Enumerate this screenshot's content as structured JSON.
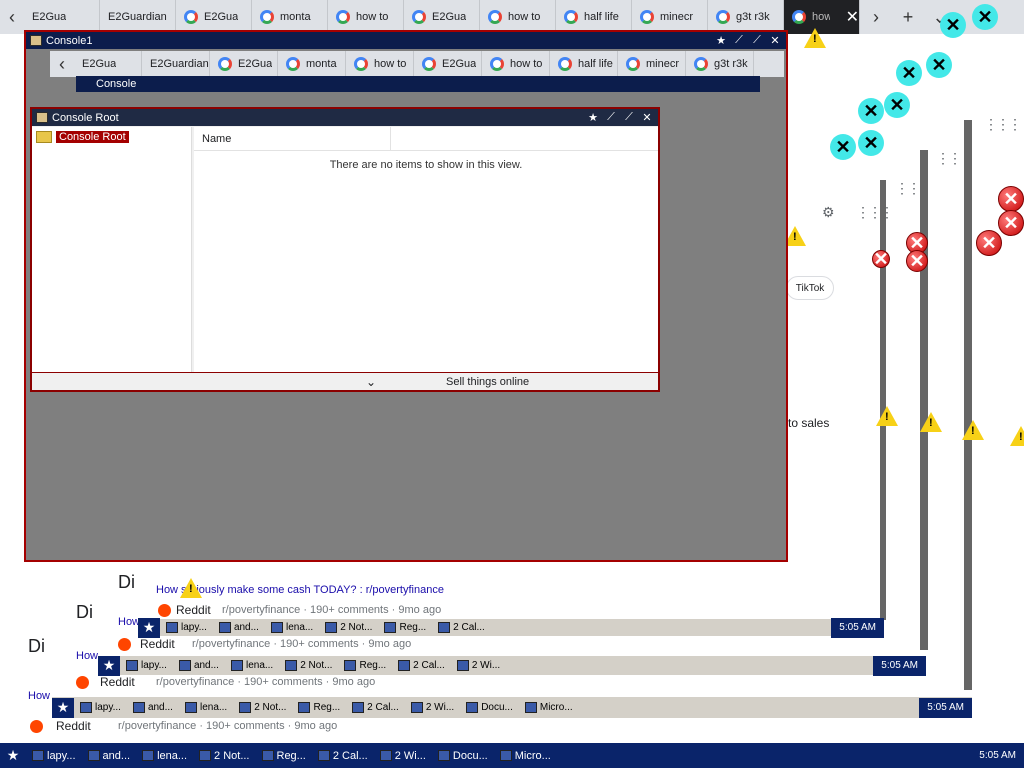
{
  "browser": {
    "tabs": [
      {
        "label": "E2Gua"
      },
      {
        "label": "E2Guardian"
      },
      {
        "label": "E2Gua"
      },
      {
        "label": "monta"
      },
      {
        "label": "how to"
      },
      {
        "label": "E2Gua"
      },
      {
        "label": "how to"
      },
      {
        "label": "half life"
      },
      {
        "label": "minecr"
      },
      {
        "label": "g3t r3k"
      },
      {
        "label": "how"
      }
    ],
    "new_tab_label": "+"
  },
  "console1": {
    "title": "Console1"
  },
  "inner_console": {
    "title": "Console"
  },
  "console_root": {
    "title": "Console Root",
    "tree_item": "Console Root",
    "column_name": "Name",
    "empty_message": "There are no items to show in this view.",
    "status_text": "Sell things online"
  },
  "background_fragments": {
    "tiktok": "TikTok",
    "to_sales": "to sales"
  },
  "reddit": {
    "result_title": "How seriously make some cash TODAY? : r/povertyfinance",
    "source": "Reddit",
    "meta": "r/povertyfinance · 190+ comments · 9mo ago",
    "how": "How",
    "di": "Di"
  },
  "taskbar": {
    "items": [
      {
        "label": "lapy..."
      },
      {
        "label": "and..."
      },
      {
        "label": "lena..."
      },
      {
        "label": "2 Not..."
      },
      {
        "label": "Reg..."
      },
      {
        "label": "2 Cal..."
      },
      {
        "label": "2 Wi..."
      },
      {
        "label": "Docu..."
      },
      {
        "label": "Micro..."
      }
    ],
    "clock": "5:05 AM"
  }
}
